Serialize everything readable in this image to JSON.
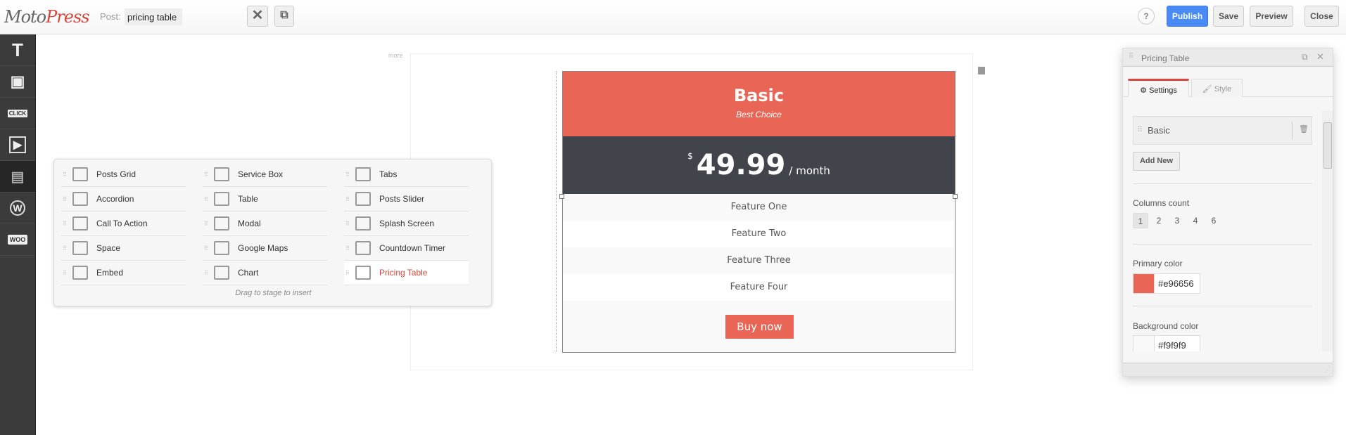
{
  "header": {
    "logo": "MotoPress",
    "post_label": "Post:",
    "post_title": "pricing table",
    "help": "?",
    "publish": "Publish",
    "save": "Save",
    "preview": "Preview",
    "close": "Close"
  },
  "sidebar": {
    "items": [
      {
        "icon": "text-icon",
        "glyph": "T"
      },
      {
        "icon": "image-icon",
        "glyph": "▣"
      },
      {
        "icon": "button-click-icon",
        "glyph": "CLICK"
      },
      {
        "icon": "video-icon",
        "glyph": "▶"
      },
      {
        "icon": "box-icon",
        "glyph": "▤",
        "active": true
      },
      {
        "icon": "wordpress-icon",
        "glyph": "W"
      },
      {
        "icon": "woo-icon",
        "glyph": "WOO"
      }
    ]
  },
  "stage": {
    "more": "more"
  },
  "pricing": {
    "title": "Basic",
    "subtitle": "Best Choice",
    "currency": "$",
    "price": "49.99",
    "period": "/ month",
    "features": [
      "Feature One",
      "Feature Two",
      "Feature Three",
      "Feature Four"
    ],
    "button": "Buy now",
    "primary_color": "#e96656"
  },
  "popup": {
    "columns": [
      [
        "Posts Grid",
        "Accordion",
        "Call To Action",
        "Space",
        "Embed"
      ],
      [
        "Service Box",
        "Table",
        "Modal",
        "Google Maps",
        "Chart"
      ],
      [
        "Tabs",
        "Posts Slider",
        "Splash Screen",
        "Countdown Timer",
        "Pricing Table"
      ]
    ],
    "active": "Pricing Table",
    "hint": "Drag to stage to insert"
  },
  "panel": {
    "title": "Pricing Table",
    "tabs": [
      "Settings",
      "Style"
    ],
    "item": "Basic",
    "add_new": "Add New",
    "columns_label": "Columns count",
    "columns_options": [
      "1",
      "2",
      "3",
      "4",
      "6"
    ],
    "columns_selected": "1",
    "primary_label": "Primary color",
    "primary_value": "#e96656",
    "bg_label": "Background color",
    "bg_value": "#f9f9f9"
  }
}
